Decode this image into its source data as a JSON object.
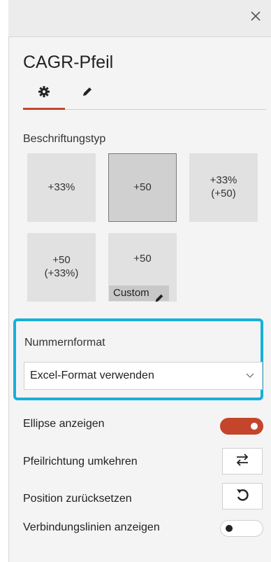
{
  "header": {
    "close_icon": "close-icon"
  },
  "title": "CAGR-Pfeil",
  "tabs": [
    {
      "name": "settings",
      "icon": "gear-icon",
      "active": true
    },
    {
      "name": "style",
      "icon": "pencil-icon",
      "active": false
    }
  ],
  "label_type": {
    "heading": "Beschriftungstyp",
    "tiles": [
      {
        "text": "+33%",
        "selected": false
      },
      {
        "text": "+50",
        "selected": true
      },
      {
        "text": "+33%\n(+50)",
        "selected": false
      },
      {
        "text": "+50\n(+33%)",
        "selected": false
      },
      {
        "text": "+50",
        "selected": false,
        "custom_label": "Custom"
      }
    ]
  },
  "number_format": {
    "heading": "Nummernformat",
    "selected_value": "Excel-Format verwenden",
    "highlight_color": "#17b0d9"
  },
  "options": [
    {
      "label": "Ellipse anzeigen",
      "control": "toggle",
      "on": true
    },
    {
      "label": "Pfeilrichtung umkehren",
      "control": "button",
      "icon": "swap-arrows-icon"
    },
    {
      "label": "Position zurücksetzen",
      "control": "button",
      "icon": "undo-icon"
    },
    {
      "label": "Verbindungslinien anzeigen",
      "control": "toggle",
      "on": false
    }
  ],
  "colors": {
    "accent": "#c4452b",
    "highlight": "#17b0d9"
  }
}
